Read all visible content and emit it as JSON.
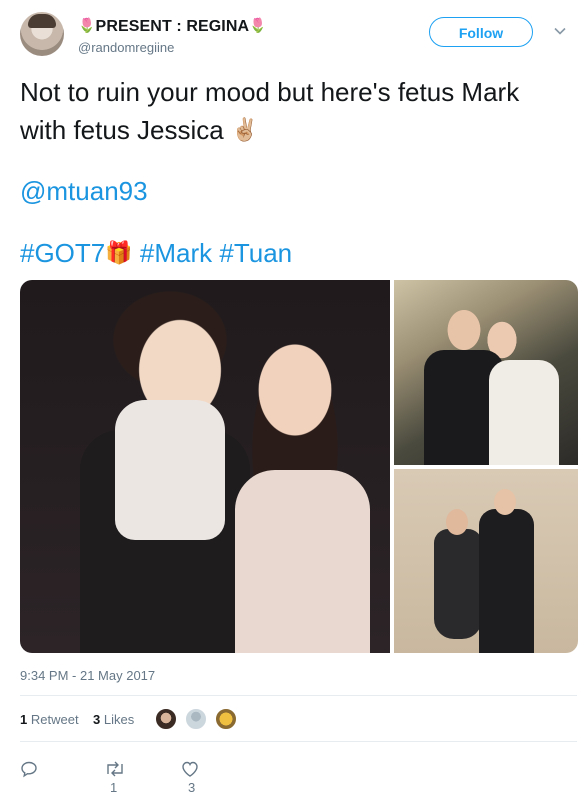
{
  "user": {
    "display_name": "PRESENT : REGINA",
    "name_emoji": "🌷",
    "handle": "@randomregiine",
    "follow_label": "Follow"
  },
  "tweet": {
    "line1": "Not to ruin your mood but here's fetus Mark with fetus Jessica",
    "line1_emoji": "✌🏼",
    "mention": "@mtuan93",
    "hashtag1": "#GOT7",
    "hashtag1_emoji": "🎁",
    "hashtag2": "#Mark",
    "hashtag3": "#Tuan"
  },
  "timestamp": "9:34 PM - 21 May 2017",
  "stats": {
    "retweets_count": "1",
    "retweets_label": "Retweet",
    "likes_count": "3",
    "likes_label": "Likes"
  },
  "actions": {
    "reply_icon": "reply-icon",
    "retweet_count": "1",
    "like_count": "3"
  },
  "colors": {
    "accent": "#1da1f2",
    "link": "#1b95e0",
    "muted": "#657786"
  }
}
